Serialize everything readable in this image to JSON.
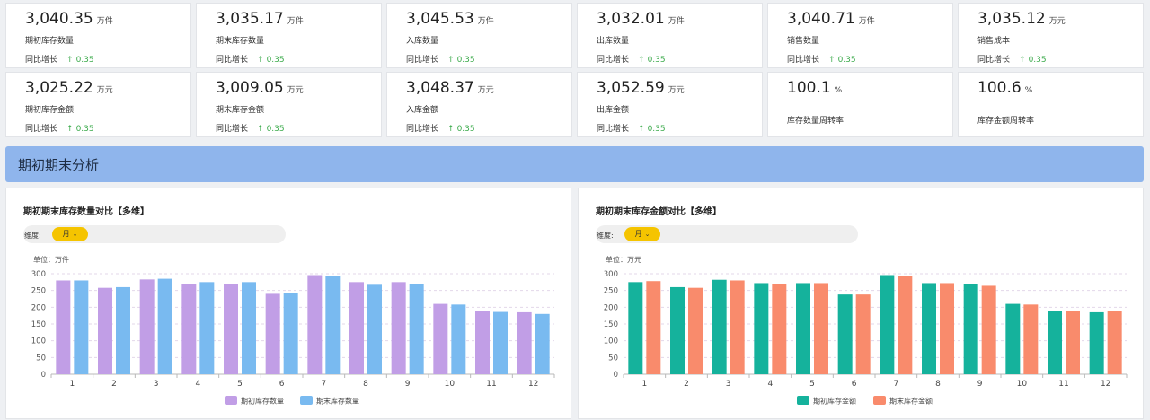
{
  "kpis": [
    {
      "value": "3,040.35",
      "unit": "万件",
      "label": "期初库存数量",
      "yoy_label": "同比增长",
      "yoy_arrow": "↑",
      "yoy_value": "0.35"
    },
    {
      "value": "3,035.17",
      "unit": "万件",
      "label": "期末库存数量",
      "yoy_label": "同比增长",
      "yoy_arrow": "↑",
      "yoy_value": "0.35"
    },
    {
      "value": "3,045.53",
      "unit": "万件",
      "label": "入库数量",
      "yoy_label": "同比增长",
      "yoy_arrow": "↑",
      "yoy_value": "0.35"
    },
    {
      "value": "3,032.01",
      "unit": "万件",
      "label": "出库数量",
      "yoy_label": "同比增长",
      "yoy_arrow": "↑",
      "yoy_value": "0.35"
    },
    {
      "value": "3,040.71",
      "unit": "万件",
      "label": "销售数量",
      "yoy_label": "同比增长",
      "yoy_arrow": "↑",
      "yoy_value": "0.35"
    },
    {
      "value": "3,035.12",
      "unit": "万元",
      "label": "销售成本",
      "yoy_label": "同比增长",
      "yoy_arrow": "↑",
      "yoy_value": "0.35"
    },
    {
      "value": "3,025.22",
      "unit": "万元",
      "label": "期初库存金额",
      "yoy_label": "同比增长",
      "yoy_arrow": "↑",
      "yoy_value": "0.35"
    },
    {
      "value": "3,009.05",
      "unit": "万元",
      "label": "期末库存金额",
      "yoy_label": "同比增长",
      "yoy_arrow": "↑",
      "yoy_value": "0.35"
    },
    {
      "value": "3,048.37",
      "unit": "万元",
      "label": "入库金额",
      "yoy_label": "同比增长",
      "yoy_arrow": "↑",
      "yoy_value": "0.35"
    },
    {
      "value": "3,052.59",
      "unit": "万元",
      "label": "出库金额",
      "yoy_label": "同比增长",
      "yoy_arrow": "↑",
      "yoy_value": "0.35"
    },
    {
      "value": "100.1",
      "unit": "%",
      "label": "库存数量周转率"
    },
    {
      "value": "100.6",
      "unit": "%",
      "label": "库存金额周转率"
    }
  ],
  "section": {
    "title": "期初期末分析"
  },
  "panels": [
    {
      "title": "期初期末库存数量对比【多维】",
      "dim_label": "维度:",
      "dim_value": "月",
      "chevron": "⌄"
    },
    {
      "title": "期初期末库存金额对比【多维】",
      "dim_label": "维度:",
      "dim_value": "月",
      "chevron": "⌄"
    }
  ],
  "chart_data": [
    {
      "type": "bar",
      "unit_label": "单位：万件",
      "categories": [
        "1",
        "2",
        "3",
        "4",
        "5",
        "6",
        "7",
        "8",
        "9",
        "10",
        "11",
        "12"
      ],
      "ylim": [
        0,
        300
      ],
      "yticks": [
        0,
        50,
        100,
        150,
        200,
        250,
        300
      ],
      "grid": true,
      "legend_position": "bottom",
      "series": [
        {
          "name": "期初库存数量",
          "color": "#c19ee6",
          "values": [
            280,
            258,
            283,
            270,
            270,
            240,
            296,
            275,
            275,
            210,
            188,
            185
          ]
        },
        {
          "name": "期末库存数量",
          "color": "#79baf0",
          "values": [
            280,
            260,
            285,
            275,
            275,
            242,
            293,
            267,
            270,
            208,
            186,
            180
          ]
        }
      ]
    },
    {
      "type": "bar",
      "unit_label": "单位：万元",
      "categories": [
        "1",
        "2",
        "3",
        "4",
        "5",
        "6",
        "7",
        "8",
        "9",
        "10",
        "11",
        "12"
      ],
      "ylim": [
        0,
        300
      ],
      "yticks": [
        0,
        50,
        100,
        150,
        200,
        250,
        300
      ],
      "grid": true,
      "legend_position": "bottom",
      "series": [
        {
          "name": "期初库存金额",
          "color": "#15b29c",
          "values": [
            275,
            260,
            282,
            272,
            272,
            238,
            296,
            272,
            268,
            210,
            190,
            185
          ]
        },
        {
          "name": "期末库存金额",
          "color": "#f98b6c",
          "values": [
            278,
            258,
            280,
            270,
            272,
            238,
            293,
            272,
            264,
            208,
            190,
            188
          ]
        }
      ]
    }
  ]
}
